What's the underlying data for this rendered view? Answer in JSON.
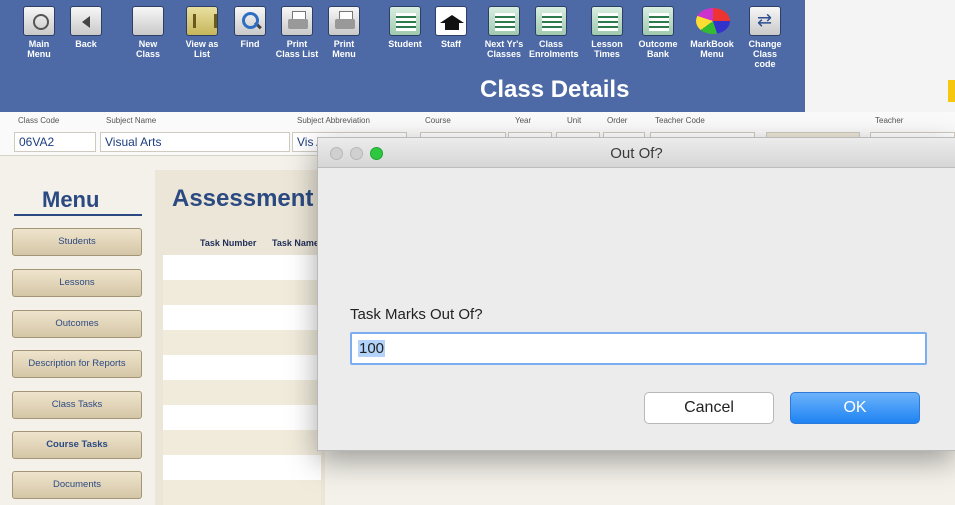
{
  "toolbar": {
    "buttons": [
      {
        "label": "Main\nMenu",
        "icon": "main-menu-icon"
      },
      {
        "label": "Back",
        "icon": "back-icon"
      },
      {
        "label": "New\nClass",
        "icon": "new-class-icon"
      },
      {
        "label": "View as\nList",
        "icon": "list-icon"
      },
      {
        "label": "Find",
        "icon": "find-icon"
      },
      {
        "label": "Print\nClass List",
        "icon": "print-icon"
      },
      {
        "label": "Print\nMenu",
        "icon": "print-icon"
      },
      {
        "label": "Student",
        "icon": "student-icon"
      },
      {
        "label": "Staff",
        "icon": "staff-icon"
      },
      {
        "label": "Next Yr's\nClasses",
        "icon": "classes-icon"
      },
      {
        "label": "Class\nEnrolments",
        "icon": "enrolments-icon"
      },
      {
        "label": "Lesson\nTimes",
        "icon": "lesson-times-icon"
      },
      {
        "label": "Outcome\nBank",
        "icon": "outcome-bank-icon"
      },
      {
        "label": "MarkBook\nMenu",
        "icon": "markbook-icon"
      },
      {
        "label": "Change\nClass code",
        "icon": "change-code-icon"
      }
    ],
    "title": "Class Details"
  },
  "fields": {
    "class_code_label": "Class Code",
    "class_code": "06VA2",
    "subject_name_label": "Subject Name",
    "subject_name": "Visual Arts",
    "subject_abbr_label": "Subject Abbreviation",
    "subject_abbr": "Vis A",
    "course_label": "Course",
    "year_label": "Year",
    "unit_label": "Unit",
    "order_label": "Order",
    "teacher_code_label": "Teacher Code",
    "teacher_label": "Teacher"
  },
  "menu": {
    "title": "Menu",
    "items": [
      "Students",
      "Lessons",
      "Outcomes",
      "Description for Reports",
      "Class Tasks",
      "Course Tasks",
      "Documents"
    ]
  },
  "assessment": {
    "title": "Assessment",
    "col_task_number": "Task Number",
    "col_task_name": "Task Name"
  },
  "dialog": {
    "title": "Out Of?",
    "prompt": "Task Marks Out Of?",
    "value": "100",
    "cancel_label": "Cancel",
    "ok_label": "OK"
  }
}
